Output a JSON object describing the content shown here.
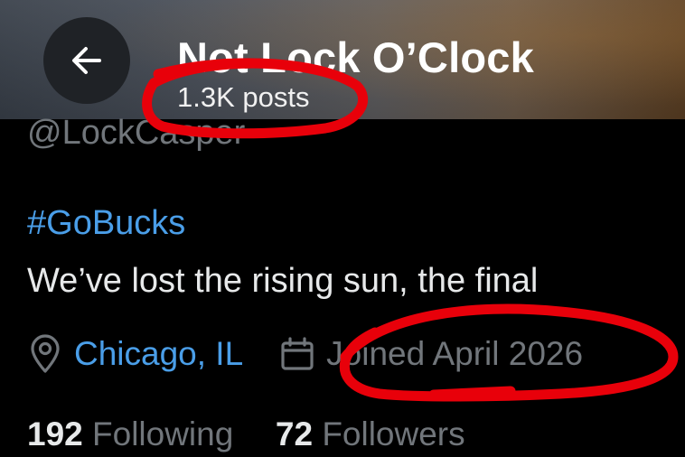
{
  "header": {
    "title": "Not Lock O’Clock",
    "posts_count": "1.3K posts",
    "back_icon": "arrow-left-icon"
  },
  "profile": {
    "handle": "@LockCasper",
    "hashtag": "#GoBucks",
    "bio": "We’ve lost the rising sun, the final",
    "location": "Chicago, IL",
    "location_icon": "map-pin-icon",
    "joined": "Joined April 2026",
    "joined_icon": "calendar-icon"
  },
  "stats": {
    "following_count": "192",
    "following_label": "Following",
    "followers_count": "72",
    "followers_label": "Followers"
  },
  "colors": {
    "link": "#4a9ee8",
    "muted": "#71767b",
    "annotation": "#e8000a"
  }
}
